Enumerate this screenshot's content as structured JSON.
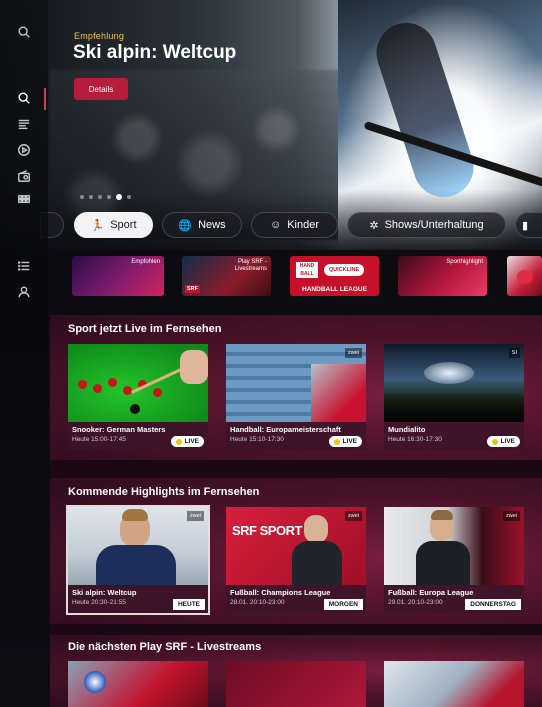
{
  "hero": {
    "kicker": "Empfehlung",
    "title": "Ski alpin: Weltcup",
    "details_label": "Details",
    "carousel": {
      "count": 6,
      "active_index": 4
    }
  },
  "sidebar": {
    "items": [
      {
        "name": "search",
        "icon": "search-icon"
      },
      {
        "name": "home",
        "icon": "home-search-icon"
      },
      {
        "name": "guide",
        "icon": "tv-guide-icon"
      },
      {
        "name": "play",
        "icon": "play-icon"
      },
      {
        "name": "radio",
        "icon": "radio-icon"
      },
      {
        "name": "categories",
        "icon": "grid-icon"
      },
      {
        "name": "list",
        "icon": "list-icon"
      },
      {
        "name": "profile",
        "icon": "profile-icon"
      }
    ]
  },
  "categories": [
    {
      "label": "Sport",
      "icon": "running-icon",
      "active": true
    },
    {
      "label": "News",
      "icon": "globe-icon",
      "active": false
    },
    {
      "label": "Kinder",
      "icon": "smile-icon",
      "active": false
    },
    {
      "label": "Shows/Unterhaltung",
      "icon": "puzzle-icon",
      "active": false
    }
  ],
  "channels": [
    {
      "label": "Empfohlen"
    },
    {
      "label": "Play SRF -\nLivestreams"
    },
    {
      "label": "HANDBALL LEAGUE"
    },
    {
      "label": "Sporthighlight"
    }
  ],
  "sections": [
    {
      "title": "Sport jetzt Live im Fernsehen",
      "cards": [
        {
          "title": "Snooker: German Masters",
          "time": "Heute 15:00-17:45",
          "badge": "LIVE"
        },
        {
          "title": "Handball: Europameisterschaft",
          "time": "Heute 15:10-17:30",
          "badge": "LIVE"
        },
        {
          "title": "Mundialito",
          "time": "Heute 16:30-17:30",
          "badge": "LIVE"
        }
      ]
    },
    {
      "title": "Kommende Highlights im Fernsehen",
      "cards": [
        {
          "title": "Ski alpin: Weltcup",
          "time": "Heute 20:30-21:55",
          "badge": "HEUTE"
        },
        {
          "title": "Fußball: Champions League",
          "time": "28.01. 20:10-23:00",
          "badge": "MORGEN"
        },
        {
          "title": "Fußball: Europa League",
          "time": "29.01. 20:10-23:00",
          "badge": "DONNERSTAG"
        }
      ]
    },
    {
      "title": "Die nächsten Play SRF - Livestreams",
      "cards": []
    }
  ],
  "colors": {
    "accent": "#b51d3a",
    "live_dot": "#f3c10f",
    "kicker": "#f2c34b"
  }
}
